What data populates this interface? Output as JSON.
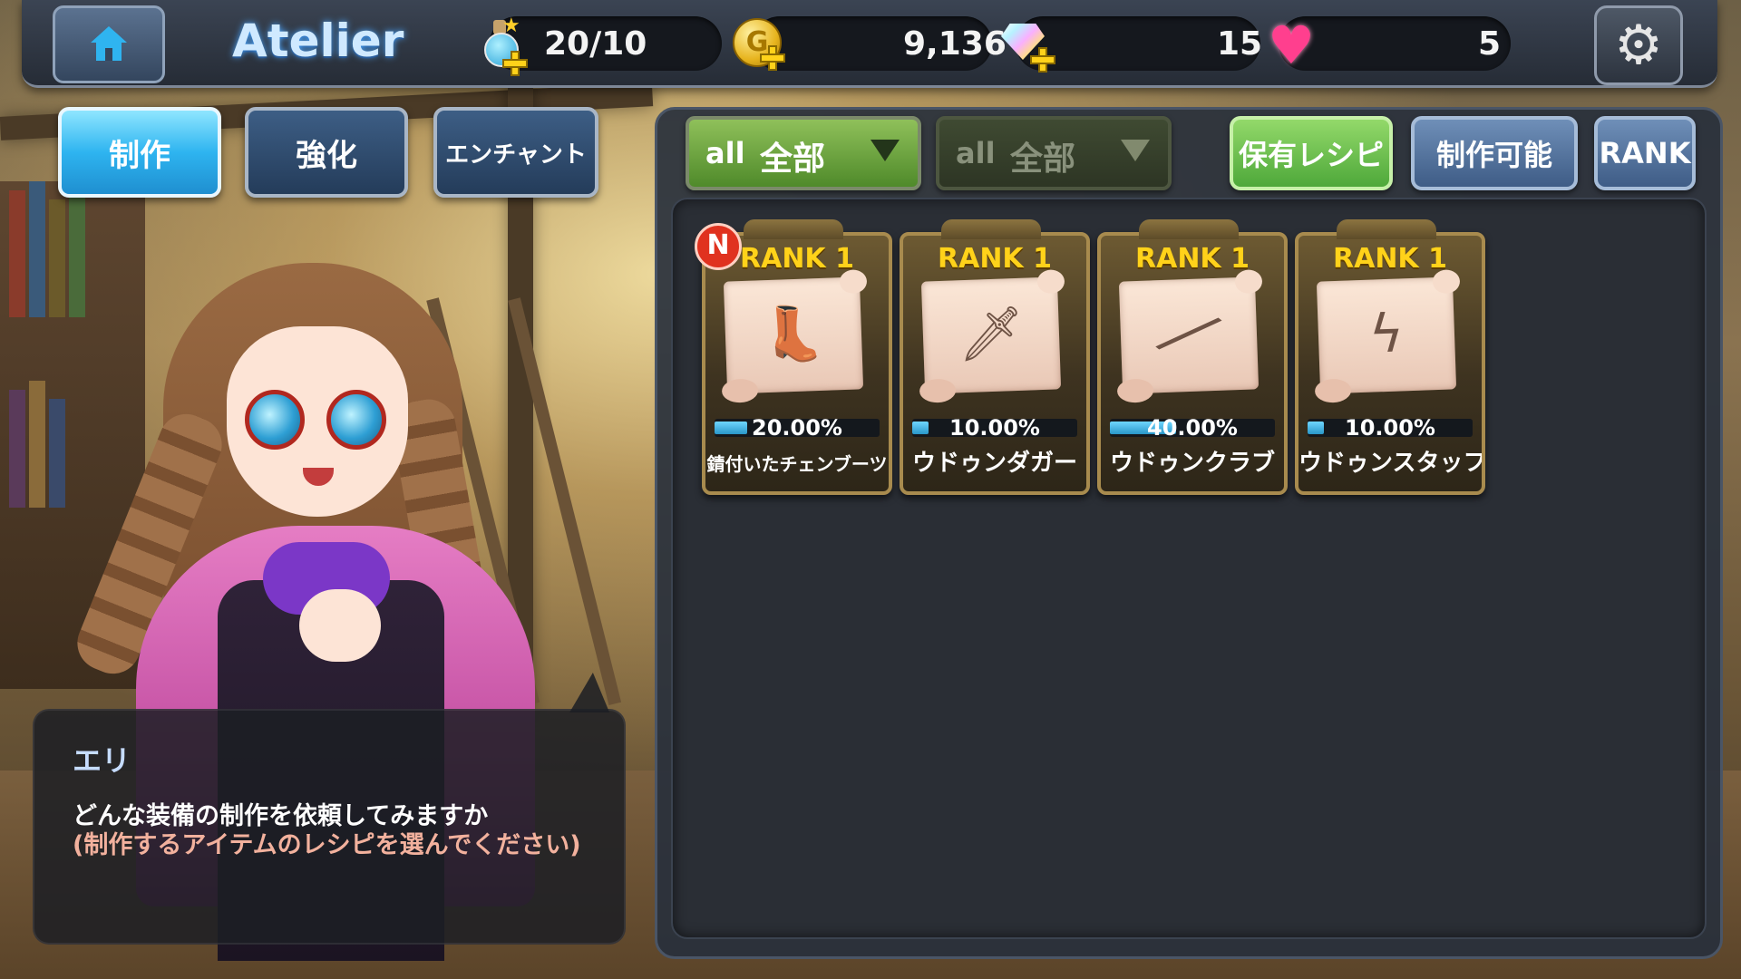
{
  "header": {
    "title": "Atelier",
    "resources": {
      "potion": "20/10",
      "gold": "9,136",
      "gems": "15",
      "hearts": "5"
    },
    "icons": [
      "home-icon",
      "potion-icon",
      "coin-icon",
      "gem-icon",
      "heart-icon",
      "gear-icon"
    ]
  },
  "tabs": [
    {
      "label": "制作",
      "active": true
    },
    {
      "label": "強化",
      "active": false
    },
    {
      "label": "エンチャント",
      "active": false
    }
  ],
  "filters": {
    "dropdown1": {
      "prefix": "all",
      "label": "全部",
      "active": true
    },
    "dropdown2": {
      "prefix": "all",
      "label": "全部",
      "active": false
    },
    "buttons": [
      {
        "label": "保有レシピ",
        "active": true
      },
      {
        "label": "制作可能",
        "active": false
      },
      {
        "label": "RANK",
        "active": false
      }
    ]
  },
  "recipes": [
    {
      "rank": "RANK 1",
      "percent": "20.00%",
      "progress": 0.2,
      "name": "錆付いたチェンブーツ",
      "is_new": true,
      "new_label": "N",
      "icon": "boot-icon"
    },
    {
      "rank": "RANK 1",
      "percent": "10.00%",
      "progress": 0.1,
      "name": "ウドゥンダガー",
      "is_new": false,
      "icon": "dagger-icon"
    },
    {
      "rank": "RANK 1",
      "percent": "40.00%",
      "progress": 0.4,
      "name": "ウドゥンクラブ",
      "is_new": false,
      "icon": "club-icon"
    },
    {
      "rank": "RANK 1",
      "percent": "10.00%",
      "progress": 0.1,
      "name": "ウドゥンスタッフ",
      "is_new": false,
      "icon": "staff-icon"
    }
  ],
  "dialog": {
    "speaker": "エリ",
    "line1": "どんな装備の制作を依頼してみますか",
    "line2": "(制作するアイテムのレシピを選んでください)"
  },
  "colors": {
    "accent_blue": "#2eb4f0",
    "filter_green": "#4ea83a",
    "rank_gold": "#ffd21a",
    "hint_text": "#f2b19d",
    "new_badge": "#e0321f"
  }
}
